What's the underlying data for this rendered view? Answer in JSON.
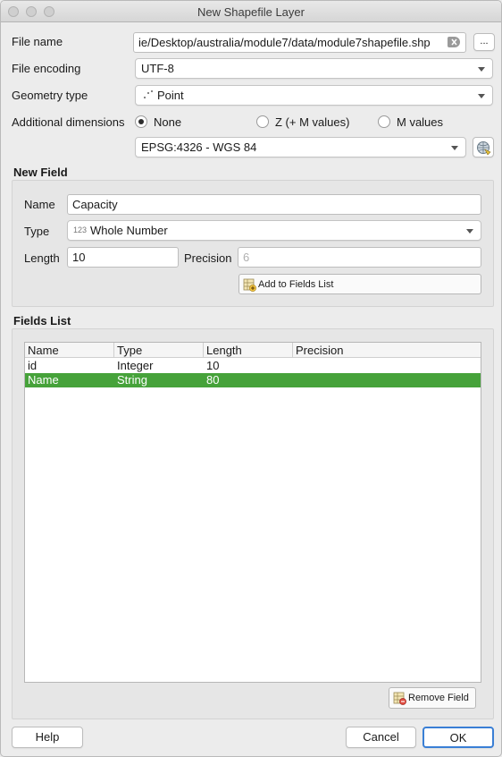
{
  "window": {
    "title": "New Shapefile Layer"
  },
  "form": {
    "file_name_label": "File name",
    "file_name_value": "ie/Desktop/australia/module7/data/module7shapefile.shp",
    "browse_label": "...",
    "file_encoding_label": "File encoding",
    "file_encoding_value": "UTF-8",
    "geometry_type_label": "Geometry type",
    "geometry_type_value": "Point",
    "additional_dimensions_label": "Additional dimensions",
    "dim_none": "None",
    "dim_z": "Z (+ M values)",
    "dim_m": "M values",
    "crs_value": "EPSG:4326 - WGS 84"
  },
  "new_field": {
    "title": "New Field",
    "name_label": "Name",
    "name_value": "Capacity",
    "type_label": "Type",
    "type_icon_text": "123",
    "type_value": "Whole Number",
    "length_label": "Length",
    "length_value": "10",
    "precision_label": "Precision",
    "precision_value": "6",
    "add_button": "Add to Fields List"
  },
  "fields_list": {
    "title": "Fields List",
    "columns": [
      "Name",
      "Type",
      "Length",
      "Precision"
    ],
    "rows": [
      [
        "id",
        "Integer",
        "10",
        ""
      ],
      [
        "Name",
        "String",
        "80",
        ""
      ]
    ],
    "selected_row": 1,
    "remove_button": "Remove Field"
  },
  "footer": {
    "help": "Help",
    "cancel": "Cancel",
    "ok": "OK"
  },
  "colors": {
    "selection": "#46a23a",
    "ok_border": "#3a7fd5"
  }
}
